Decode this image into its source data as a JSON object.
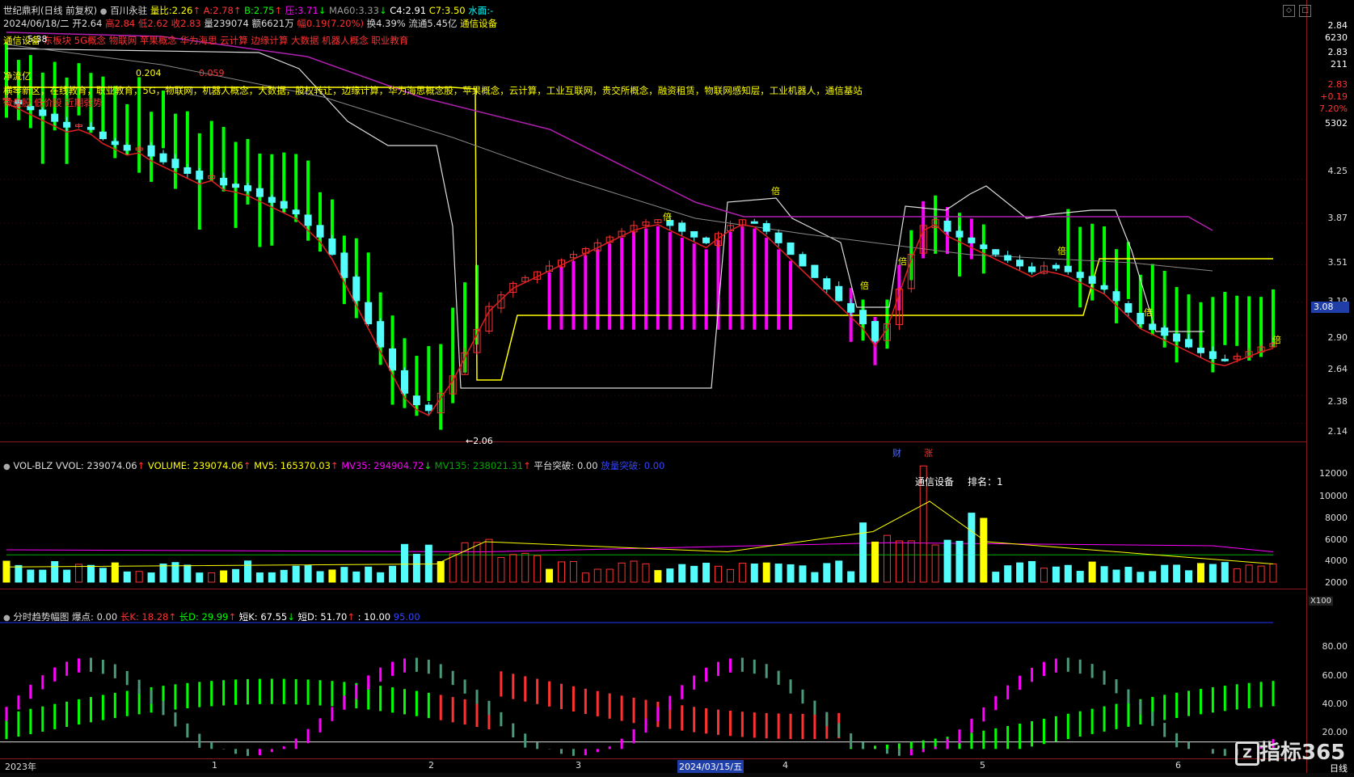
{
  "header": {
    "stock_name": "世纪鼎利(日线 前复权)",
    "indicator_name": "百川永驻",
    "liangbi_label": "量比:",
    "liangbi_value": "2.26",
    "a_label": "A:",
    "a_value": "2.78",
    "b_label": "B:",
    "b_value": "2.75",
    "ya_label": "压:",
    "ya_value": "3.71",
    "ma60_label": "MA60:",
    "ma60_value": "3.33",
    "c4_label": "C4:",
    "c4_value": "2.91",
    "c7_label": "C7:",
    "c7_value": "3.50",
    "shuimian_label": "水面:",
    "shuimian_value": "-"
  },
  "quote": {
    "date": "2024/06/18/二",
    "open": "开2.64",
    "high": "高2.84",
    "low": "低2.62",
    "close": "收2.83",
    "volume": "量239074",
    "amount": "额6621万",
    "change": "幅0.19(7.20%)",
    "turnover": "换4.39%",
    "float_value": "流通5.45亿",
    "industry": "通信设备"
  },
  "concepts": {
    "line1_prefix": "通信设备",
    "line1": "东板块 5G概念 物联网 苹果概念 华为海思 云计算 边缘计算 大数据 机器人概念 职业教育",
    "net_inflow_label": "净流亿",
    "flow_a": "0.204",
    "flow_b": "0.059",
    "line2": "横琴新区，在线教育，职业教育，5G，物联网，机器人概念，大数据，股权转让，边缘计算，华为海思概念股，苹果概念，云计算，工业互联网，贵交所概念，融资租赁，物联网感知层，工业机器人，通信基站",
    "line3": "微盘股 低价股 近期弱势"
  },
  "price_axis": {
    "ticks": [
      "4.25",
      "3.87",
      "3.51",
      "3.19",
      "2.90",
      "2.64",
      "2.38",
      "2.14"
    ],
    "current": "3.08",
    "top_readouts": [
      "2.84",
      "6230",
      "2.83",
      "211",
      "2.83",
      "+0.19",
      "7.20%",
      "5302"
    ]
  },
  "annotations": {
    "bei": "倍",
    "low_price": "2.06",
    "cai": "财",
    "zhang": "涨",
    "stock_label_start": "5.38"
  },
  "volume_panel": {
    "name": "VOL-BLZ",
    "vvol": "VVOL: 239074.06",
    "volume": "VOLUME: 239074.06",
    "mv5": "MV5: 165370.03",
    "mv35": "MV35: 294904.72",
    "mv135": "MV135: 238021.31",
    "platform": "平台突破: 0.00",
    "volume_break": "放量突破: 0.00",
    "rank_industry": "通信设备",
    "rank_label": "排名：1",
    "ticks": [
      "12000",
      "10000",
      "8000",
      "6000",
      "4000",
      "2000"
    ],
    "unit": "X100"
  },
  "trend_panel": {
    "name": "分时趋势幅图",
    "baodian": "爆点: 0.00",
    "changk": "长K: 18.28",
    "changd": "长D: 29.99",
    "duank": "短K: 67.55",
    "duand": "短D: 51.70",
    "ten": ": 10.00",
    "ninetyfive": "95.00",
    "ticks": [
      "80.00",
      "60.00",
      "40.00",
      "20.00"
    ]
  },
  "x_axis": {
    "labels": [
      "2023年",
      "1",
      "2",
      "3",
      "2024/03/15/五",
      "4",
      "5",
      "6"
    ],
    "period": "日线"
  },
  "watermark": "指标365",
  "colors": {
    "up": "#ff3232",
    "down": "#54fcfc",
    "yellow": "#ffff00",
    "magenta": "#ff00ff",
    "green": "#00ff00",
    "border": "#8a1a1a"
  },
  "chart_data": {
    "type": "candlestick",
    "price_range": [
      2.06,
      5.38
    ],
    "closes": [
      4.95,
      4.9,
      4.85,
      4.8,
      4.75,
      4.7,
      4.72,
      4.68,
      4.6,
      4.55,
      4.5,
      4.52,
      4.45,
      4.4,
      4.35,
      4.3,
      4.25,
      4.28,
      4.2,
      4.18,
      4.15,
      4.1,
      4.05,
      4.0,
      3.95,
      3.85,
      3.75,
      3.6,
      3.4,
      3.2,
      3.0,
      2.8,
      2.6,
      2.4,
      2.3,
      2.25,
      2.4,
      2.55,
      2.75,
      2.95,
      3.15,
      3.25,
      3.35,
      3.4,
      3.45,
      3.5,
      3.55,
      3.6,
      3.65,
      3.7,
      3.75,
      3.8,
      3.85,
      3.88,
      3.9,
      3.85,
      3.8,
      3.75,
      3.7,
      3.78,
      3.85,
      3.9,
      3.88,
      3.8,
      3.7,
      3.6,
      3.5,
      3.4,
      3.3,
      3.2,
      3.1,
      3.0,
      2.85,
      3.0,
      3.3,
      3.6,
      3.85,
      3.9,
      3.8,
      3.75,
      3.7,
      3.65,
      3.6,
      3.55,
      3.5,
      3.45,
      3.5,
      3.48,
      3.45,
      3.4,
      3.35,
      3.3,
      3.2,
      3.1,
      3.0,
      2.95,
      2.9,
      2.85,
      2.8,
      2.75,
      2.7,
      2.68,
      2.72,
      2.76,
      2.8,
      2.83
    ],
    "volume_range": [
      0,
      12000
    ]
  }
}
